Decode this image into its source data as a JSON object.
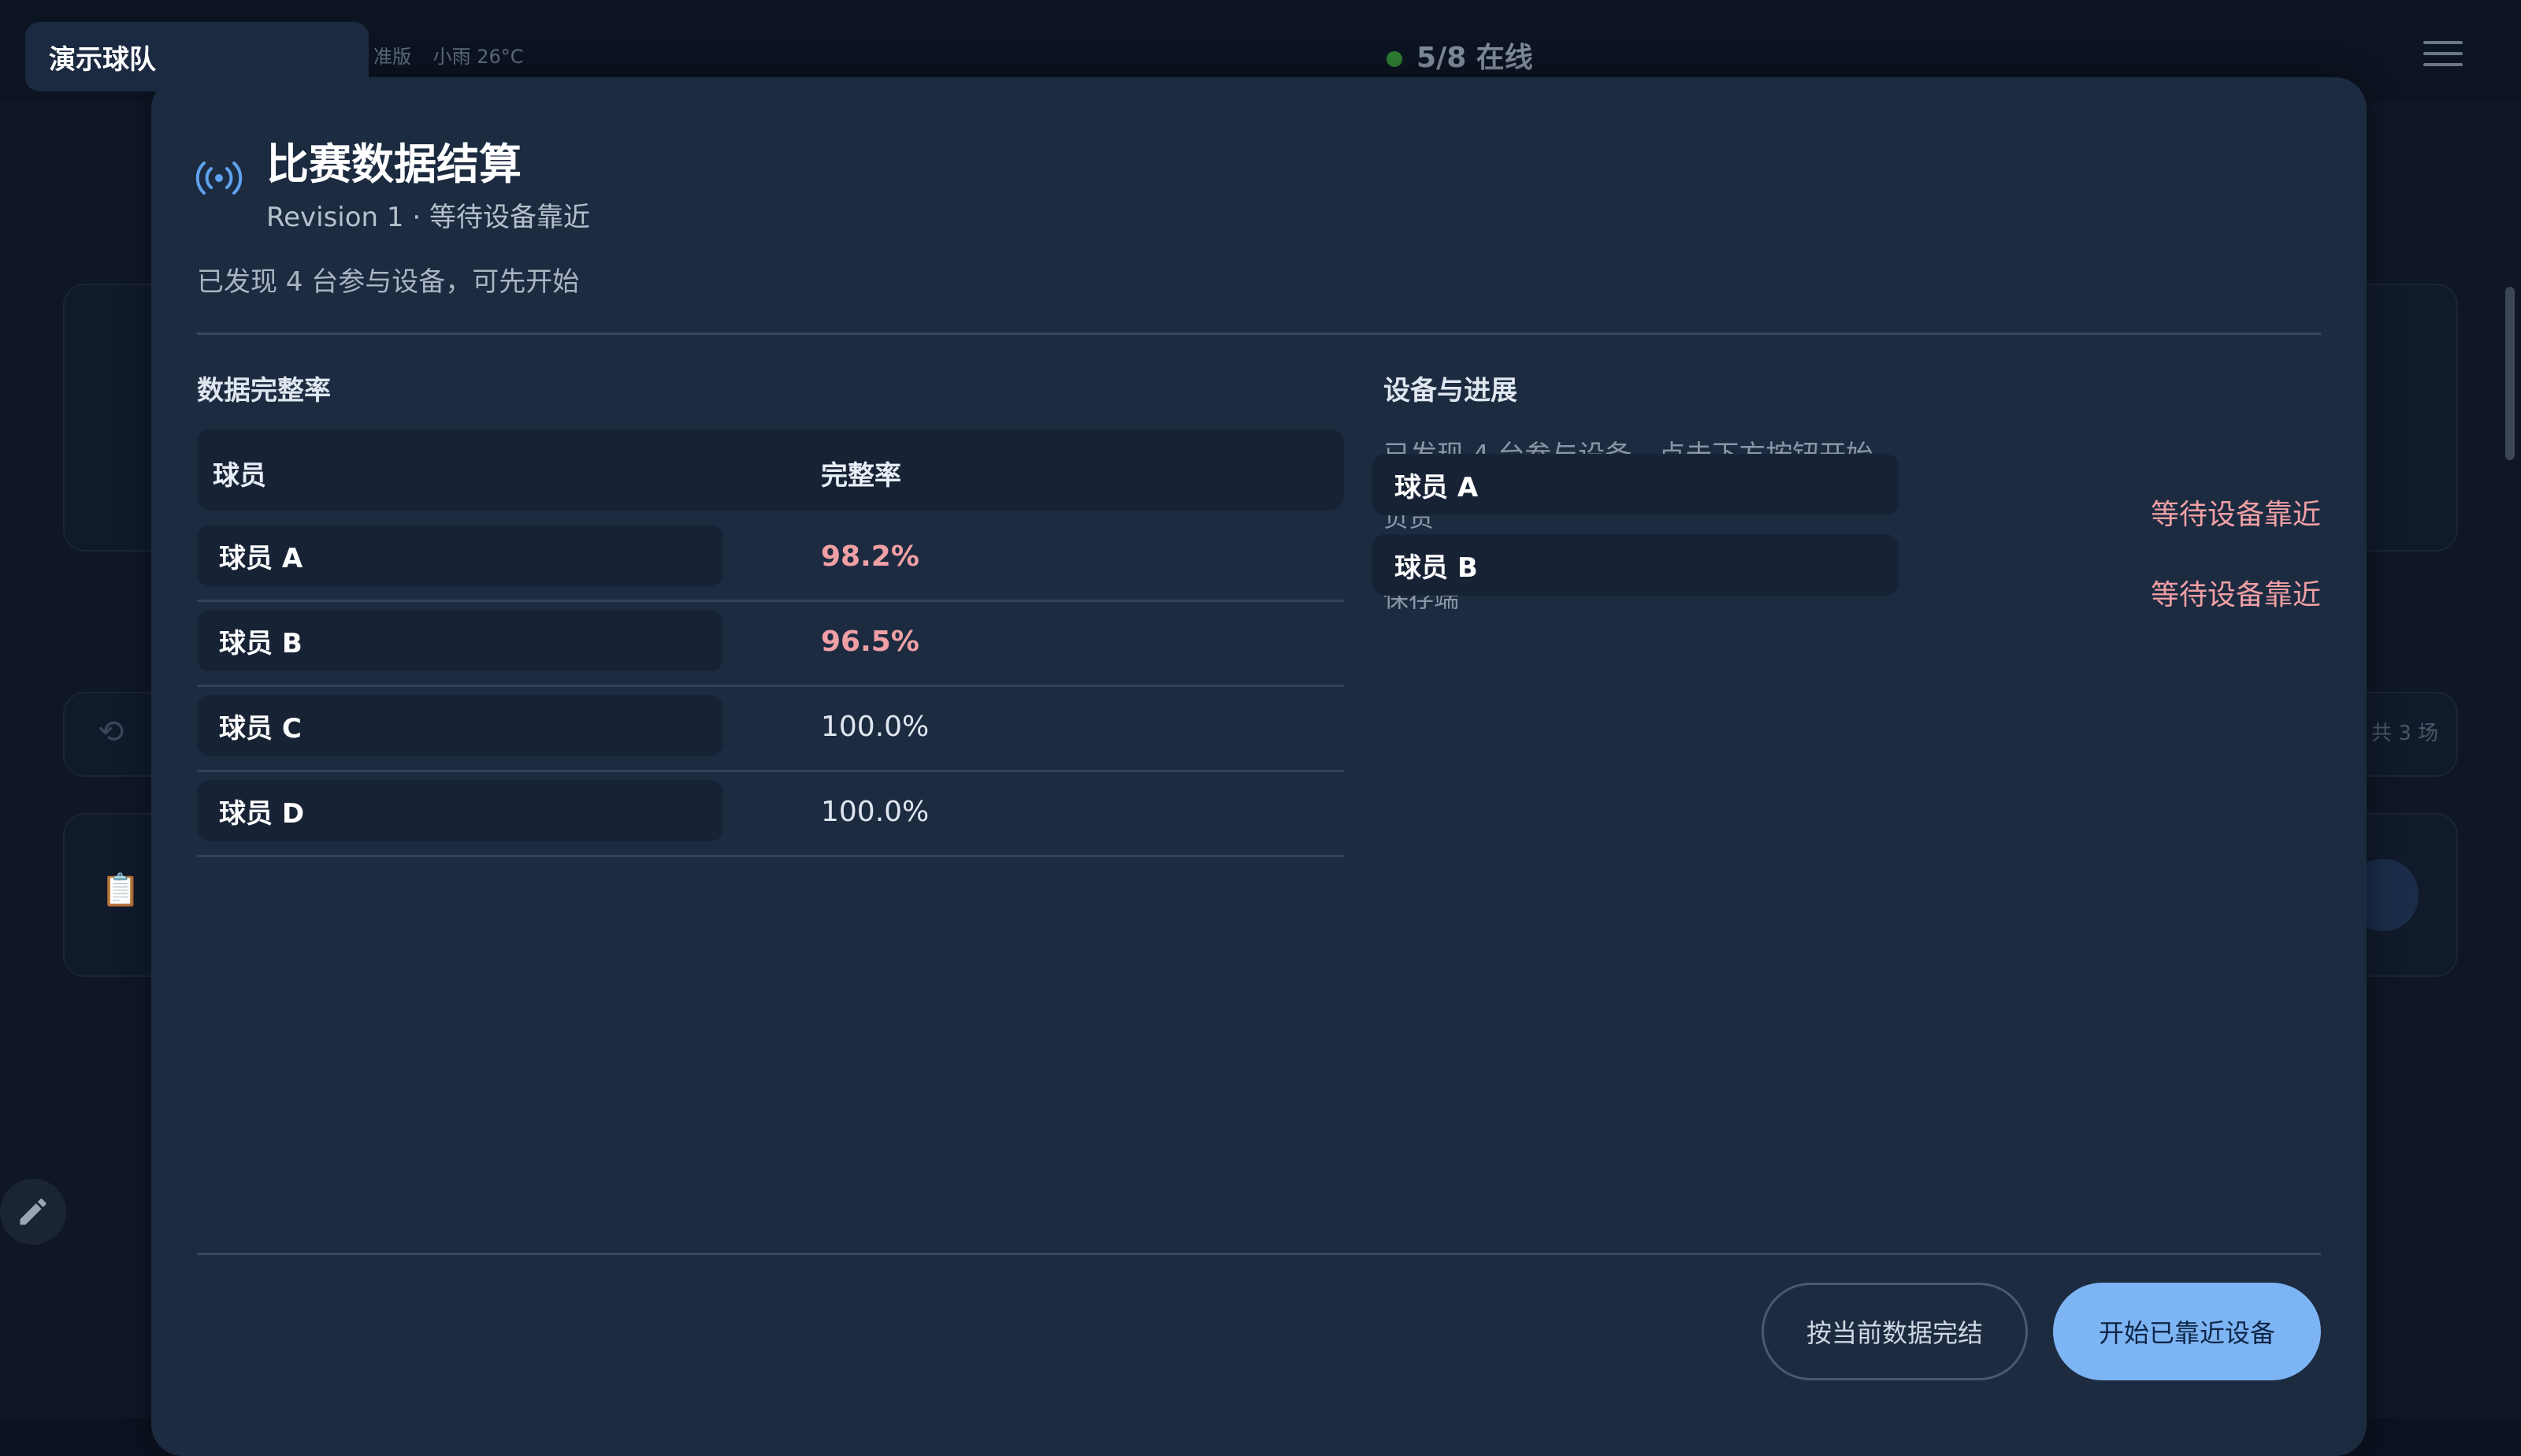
{
  "team": {
    "name": "演示球队"
  },
  "topbar": {
    "online": "5/8 在线",
    "weather": "小雨 26°C",
    "weather_prefix": "准版"
  },
  "background": {
    "matches_hint": "共 3 场"
  },
  "dialog": {
    "title": "比赛数据结算",
    "subtitle": "Revision 1 · 等待设备靠近",
    "note": "已发现 4 台参与设备，可先开始"
  },
  "completeness": {
    "section_title": "数据完整率",
    "columns": [
      "球员",
      "完整率"
    ],
    "rows": [
      {
        "player": "球员 A",
        "rate": "98.2%",
        "state": "warn"
      },
      {
        "player": "球员 B",
        "rate": "96.5%",
        "state": "warn"
      },
      {
        "player": "球员 C",
        "rate": "100.0%",
        "state": "ok"
      },
      {
        "player": "球员 D",
        "rate": "100.0%",
        "state": "ok"
      }
    ]
  },
  "devices": {
    "section_title": "设备与进展",
    "hint": "已发现 4 台参与设备，点击下方按钮开始。",
    "items": [
      {
        "player": "球员 A",
        "role": "负责",
        "status": "等待设备靠近"
      },
      {
        "player": "球员 B",
        "role": "保存端",
        "status": "等待设备靠近"
      }
    ]
  },
  "actions": {
    "finish_label": "按当前数据完结",
    "start_label": "开始已靠近设备"
  },
  "colors": {
    "warn": "#f0a0a4",
    "primary": "#7db4f3",
    "modal_bg": "#1d2b41"
  }
}
